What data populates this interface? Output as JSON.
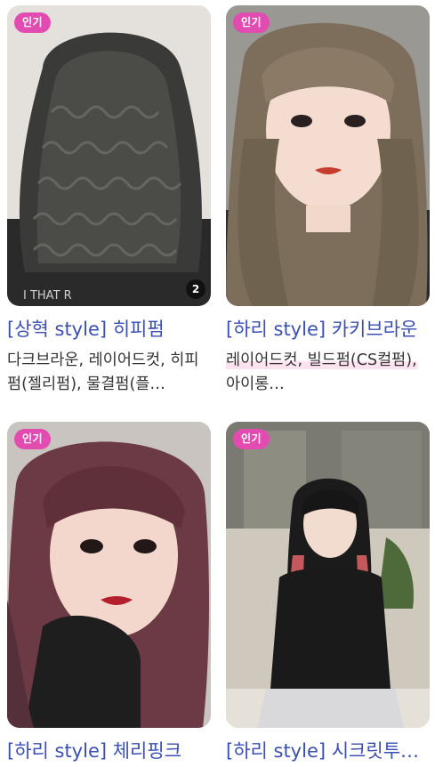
{
  "cards": [
    {
      "badge": "인기",
      "count": "2",
      "title": "[상혁 style] 히피펌",
      "desc": "다크브라운, 레이어드컷, 히피펌(젤리펌), 물결펌(플…"
    },
    {
      "badge": "인기",
      "title": "[하리 style] 카키브라운",
      "desc_hl": "레이어드컷, 빌드펌(CS컬펌),",
      "desc_rest": " 아이롱…"
    },
    {
      "badge": "인기",
      "title": "[하리 style] 체리핑크"
    },
    {
      "badge": "인기",
      "title": "[하리 style] 시크릿투…"
    }
  ],
  "colors": {
    "badge_bg": "#e24bb0",
    "title_link": "#3c4fb5",
    "highlight": "#fde3ef"
  }
}
